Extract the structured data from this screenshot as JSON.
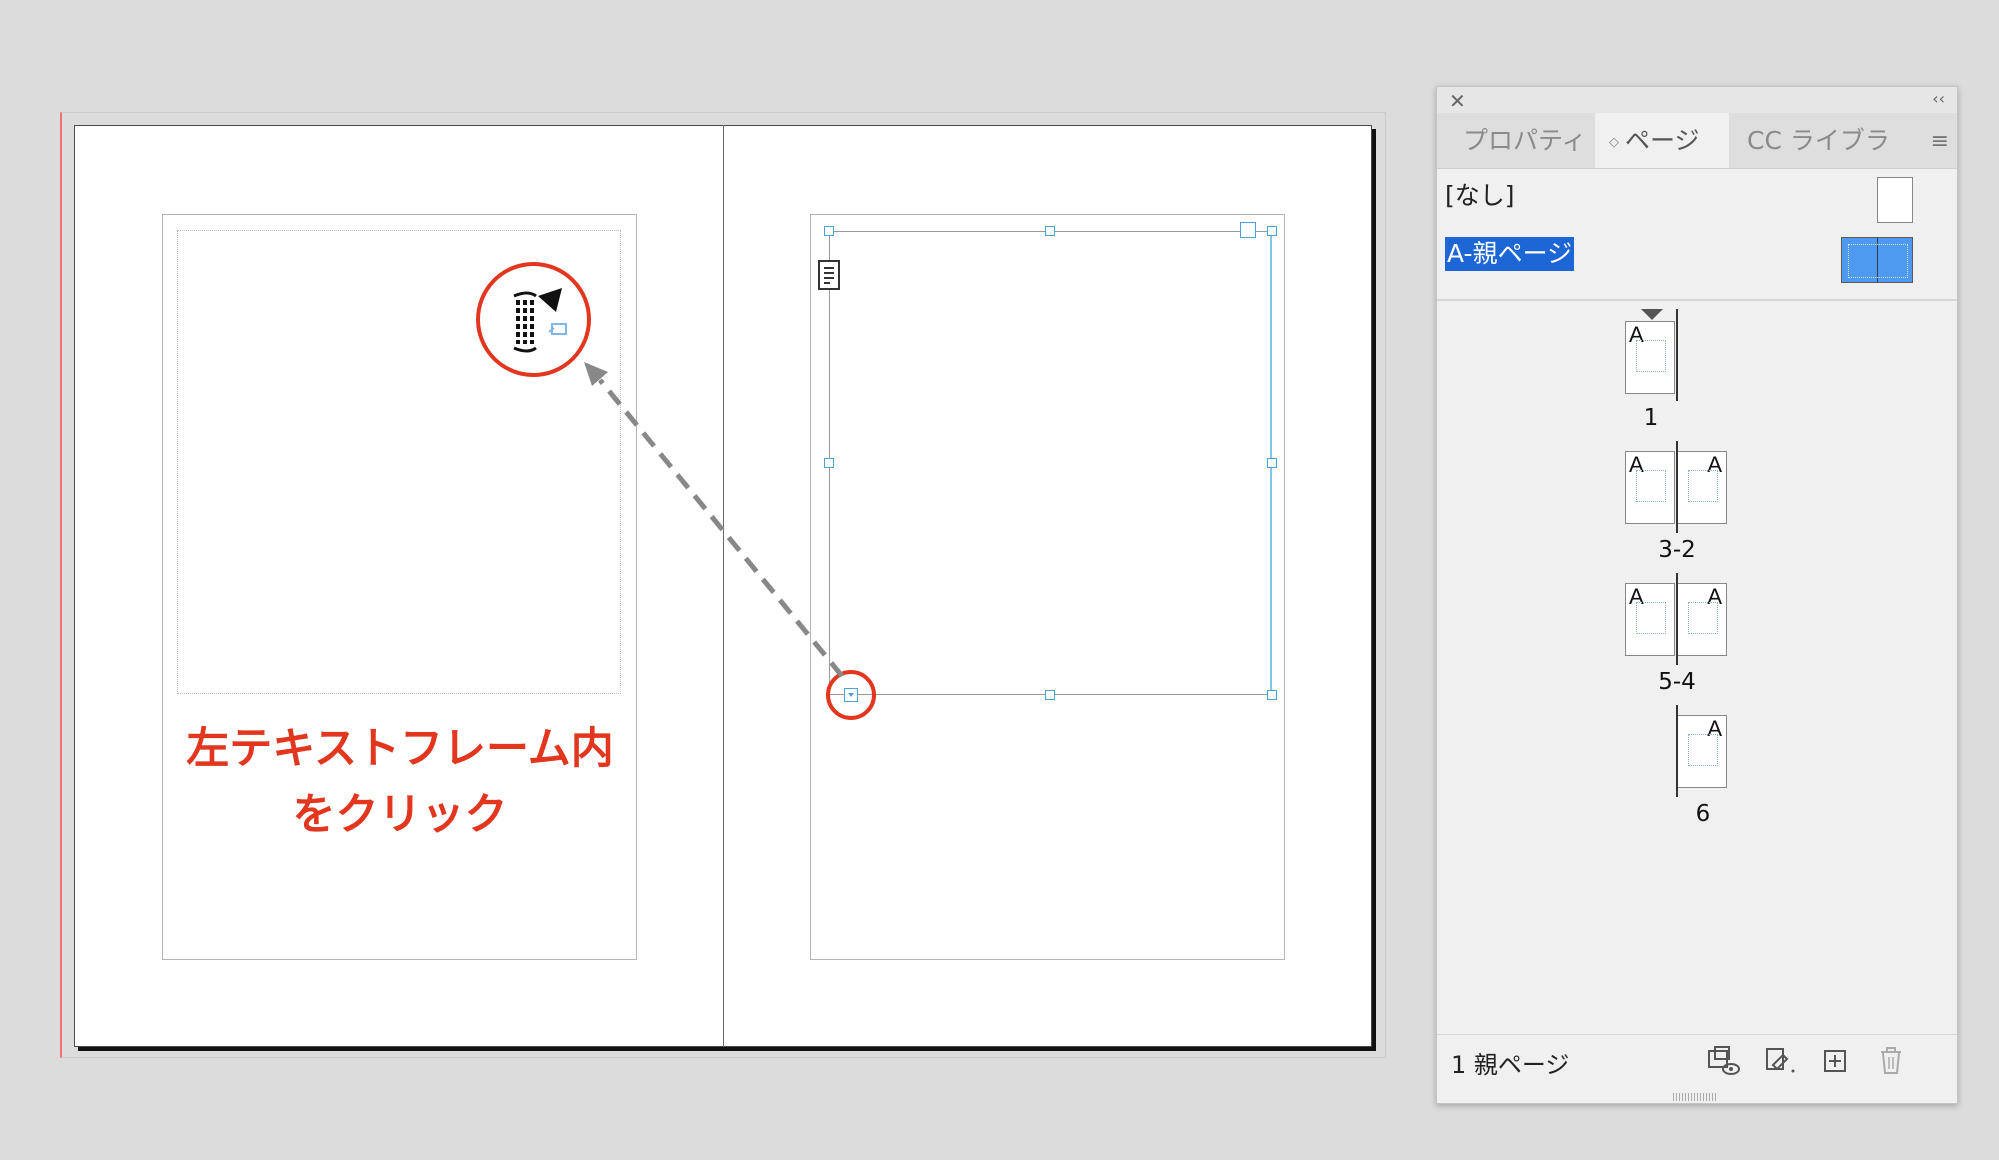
{
  "document": {
    "instruction_line1": "左テキストフレーム内",
    "instruction_line2": "をクリック"
  },
  "panel": {
    "tabs": [
      {
        "label": "プロパティ",
        "active": false
      },
      {
        "label": "ページ",
        "active": true
      },
      {
        "label": "CC ライブラ",
        "active": false
      }
    ],
    "masters": [
      {
        "label": "[なし]",
        "selected": false
      },
      {
        "label": "A-親ページ",
        "selected": true
      }
    ],
    "pages": [
      {
        "label": "1",
        "letters": [
          "A"
        ]
      },
      {
        "label": "3-2",
        "letters": [
          "A",
          "A"
        ]
      },
      {
        "label": "5-4",
        "letters": [
          "A",
          "A"
        ]
      },
      {
        "label": "6",
        "letters": [
          "A"
        ]
      }
    ],
    "status": "1 親ページ",
    "icons": [
      "edit-page-size-icon",
      "new-page-options-icon",
      "new-page-icon",
      "delete-page-icon"
    ],
    "colors": {
      "selection": "#1d66d6",
      "master_thumb": "#4d9af0"
    }
  },
  "annotation_color": "#e2361e"
}
